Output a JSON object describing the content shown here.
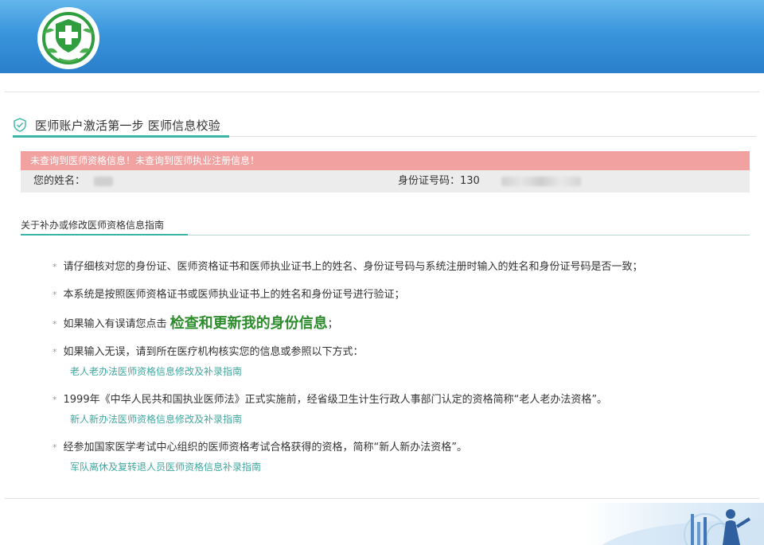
{
  "header": {
    "logo_icon": "medical-cross-leaf-icon",
    "colors": {
      "top": "#64b6ec",
      "bottom": "#2a7fca"
    }
  },
  "step": {
    "icon": "shield-check-icon",
    "title": "医师账户激活第一步 医师信息校验"
  },
  "alert": {
    "message": "未查询到医师资格信息！未查询到医师执业注册信息！",
    "color": "#f2a1a1"
  },
  "user": {
    "name_label": "您的姓名：",
    "id_label": "身份证号码：130"
  },
  "guide": {
    "title": "关于补办或修改医师资格信息指南",
    "star": "*",
    "items": [
      {
        "text": "请仔细核对您的身份证、医师资格证书和医师执业证书上的姓名、身份证号码与系统注册时输入的姓名和身份证号码是否一致；"
      },
      {
        "text": "本系统是按照医师资格证书或医师执业证书上的姓名和身份证号进行验证；"
      },
      {
        "text_before": "如果输入有误请您点击",
        "link_big": "检查和更新我的身份信息",
        "text_after": "；"
      },
      {
        "text": "如果输入无误，请到所在医疗机构核实您的信息或参照以下方式：",
        "link": "老人老办法医师资格信息修改及补录指南"
      },
      {
        "text": "1999年《中华人民共和国执业医师法》正式实施前，经省级卫生计生行政人事部门认定的资格简称“老人老办法资格”。",
        "link": "新人新办法医师资格信息修改及补录指南"
      },
      {
        "text": "经参加国家医学考试中心组织的医师资格考试合格获得的资格，简称“新人新办法资格”。",
        "link": "军队离休及复转退人员医师资格信息补录指南"
      }
    ]
  },
  "colors": {
    "accent": "#39b5a5",
    "link": "#3fa8a0",
    "highlight": "#2c8c2c"
  }
}
